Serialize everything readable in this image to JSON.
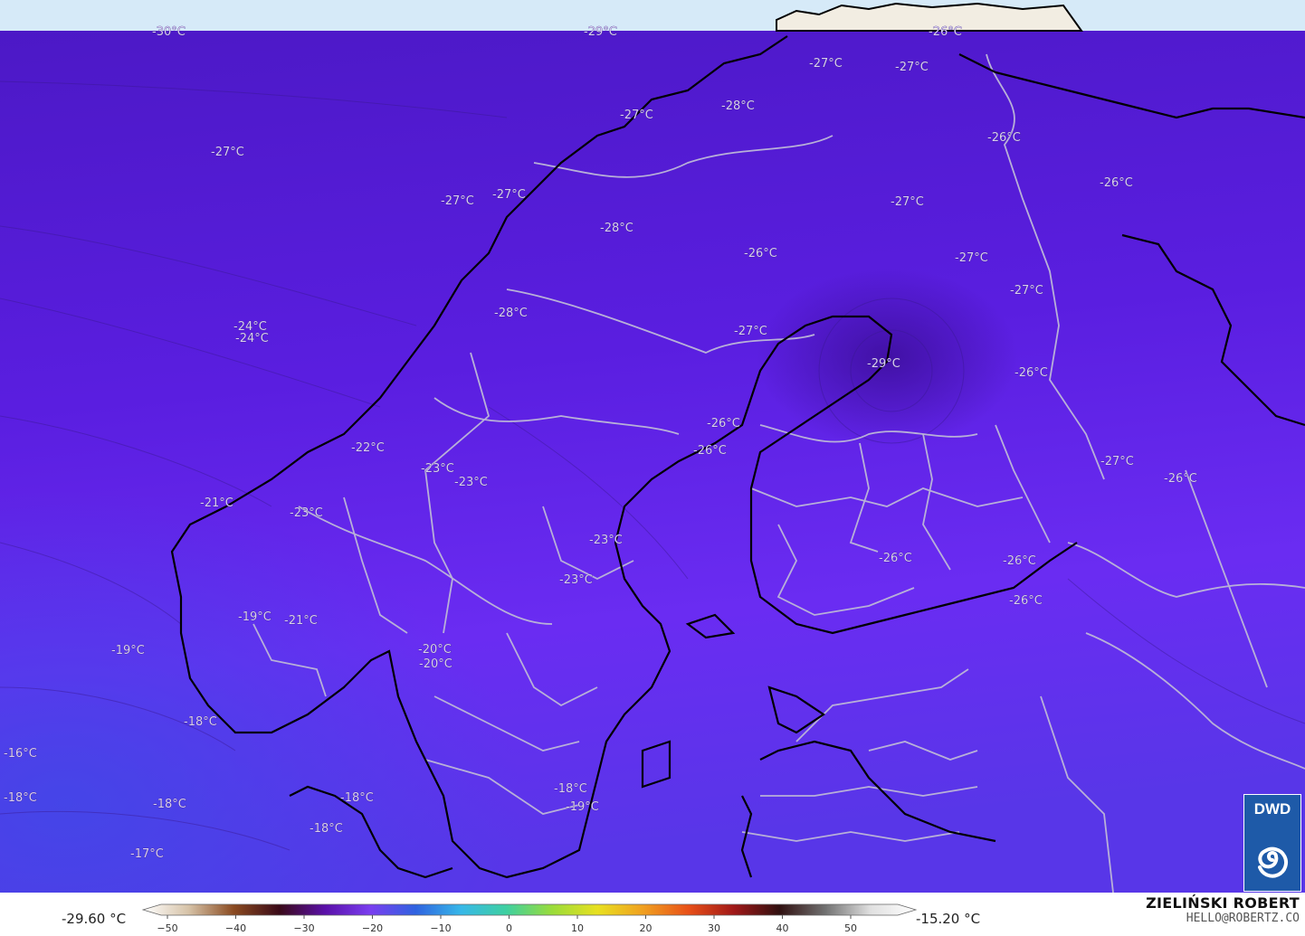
{
  "map": {
    "temperature_labels": [
      "-30°C",
      "-29°C",
      "-26°C",
      "-27°C",
      "-27°C",
      "-27°C",
      "-28°C",
      "-26°C",
      "-27°C",
      "-26°C",
      "-27°C",
      "-27°C",
      "-28°C",
      "-27°C",
      "-26°C",
      "-27°C",
      "-27°C",
      "-24°C",
      "-24°C",
      "-28°C",
      "-27°C",
      "-29°C",
      "-26°C",
      "-26°C",
      "-26°C",
      "-22°C",
      "-23°C",
      "-23°C",
      "-27°C",
      "-26°C",
      "-21°C",
      "-23°C",
      "-23°C",
      "-23°C",
      "-26°C",
      "-26°C",
      "-26°C",
      "-19°C",
      "-21°C",
      "-19°C",
      "-20°C",
      "-20°C",
      "-18°C",
      "-16°C",
      "-18°C",
      "-18°C",
      "-18°C",
      "-18°C",
      "-18°C",
      "-19°C",
      "-17°C"
    ]
  },
  "legend": {
    "min_label": "-29.60 °C",
    "max_label": "-15.20 °C",
    "ticks": [
      "−50",
      "−40",
      "−30",
      "−20",
      "−10",
      "0",
      "10",
      "20",
      "30",
      "40",
      "50"
    ],
    "colors": [
      "#ffffff",
      "#d6c3a8",
      "#8a4a20",
      "#3a0a18",
      "#5a10a8",
      "#7a3ef0",
      "#2f63e0",
      "#37b8e8",
      "#3fd0a0",
      "#9adc3a",
      "#e8e020",
      "#f0a020",
      "#e85018",
      "#a01818",
      "#301010",
      "#707070",
      "#e0e0e0",
      "#ffffff"
    ]
  },
  "credit": {
    "name": "ZIELIŃSKI ROBERT",
    "email": "HELLO@ROBERTZ.CO"
  },
  "logo": {
    "text": "DWD"
  }
}
